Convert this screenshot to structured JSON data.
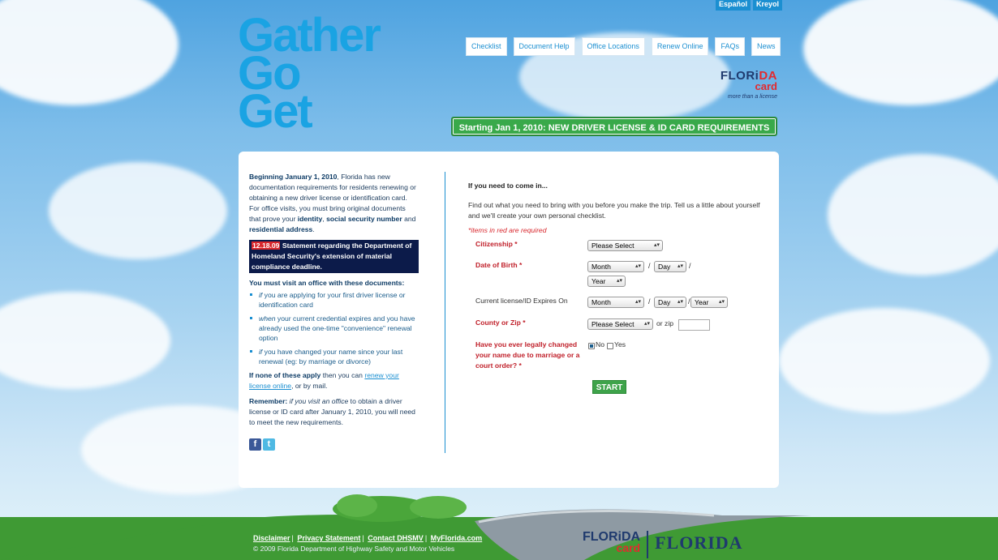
{
  "language_links": [
    "Español",
    "Kreyol"
  ],
  "logo": [
    "Gather",
    "Go",
    "Get"
  ],
  "nav": [
    "Checklist",
    "Document Help",
    "Office Locations",
    "Renew Online",
    "FAQs",
    "News"
  ],
  "florida_card": {
    "florida": "FLORi",
    "florida_accent": "DA",
    "card": "card",
    "tagline": "more than a license"
  },
  "banner": "Starting Jan 1, 2010: NEW DRIVER LICENSE & ID CARD REQUIREMENTS",
  "left": {
    "intro_bold": "Beginning January 1, 2010",
    "intro_text": ", Florida has new documentation requirements for residents renewing or obtaining a new driver license or identification card. For office visits, you must bring original documents that prove your ",
    "identity": "identity",
    "comma": ",",
    "ssn": "social security number",
    "and": " and ",
    "address": "residential address",
    "period": ".",
    "notice_date": "12.18.09",
    "notice_text": " Statement regarding the Department of Homeland Security's extension of material compliance deadline.",
    "must_visit": "You must visit an office with these documents:",
    "items": [
      {
        "em": "if",
        "text": " you are applying for your first driver license or identification card"
      },
      {
        "em": "when",
        "text": " your current credential expires and you have already used the one-time \"convenience\" renewal option"
      },
      {
        "em": "if",
        "text": " you have changed your name since your last renewal (eg: by marriage or divorce)"
      }
    ],
    "none_bold": "If none of these apply",
    "none_text": " then you can ",
    "renew_link": "renew your license online",
    "none_end": ", or by mail.",
    "remember_bold": "Remember:",
    "remember_em": " if you visit an office",
    "remember_text": " to obtain a driver license or ID card after January 1, 2010, you will need to meet the new requirements."
  },
  "right": {
    "heading": "If you need to come in...",
    "intro": "Find out what you need to bring with you before you make the trip. Tell us a little about yourself and we'll create your own personal checklist.",
    "required_note": "*items in red are required",
    "citizenship_label": "Citizenship *",
    "citizenship_value": "Please Select",
    "dob_label": "Date of Birth *",
    "expires_label": "Current license/ID Expires On",
    "month": "Month",
    "day": "Day",
    "year": "Year",
    "county_label": "County or Zip *",
    "county_value": "Please Select",
    "or_zip": "or zip",
    "name_change_label": "Have you ever legally changed your name due to marriage or a court order? *",
    "no": "No",
    "yes": "Yes",
    "start": "START"
  },
  "footer": {
    "links": [
      "Disclaimer",
      "Privacy Statement",
      "Contact DHSMV",
      "MyFlorida.com"
    ],
    "copyright": "© 2009 Florida Department of Highway Safety and Motor Vehicles",
    "florida_card": "FLORiDA",
    "card": "card",
    "florida": "FLORIDA"
  }
}
